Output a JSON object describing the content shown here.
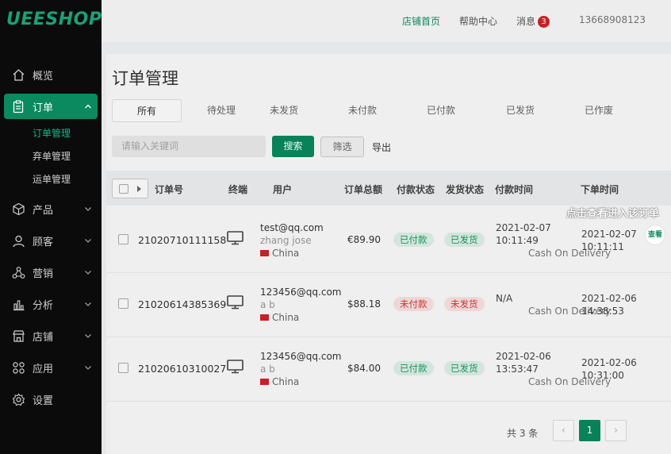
{
  "brand": {
    "logo": "UEESHOP",
    "accent": "#0a8a5e"
  },
  "sidebar": {
    "items": [
      {
        "label": "概览",
        "icon": "home-icon"
      },
      {
        "label": "订单",
        "icon": "clipboard-icon",
        "active": true,
        "expanded": true,
        "children": [
          "订单管理",
          "弃单管理",
          "运单管理"
        ]
      },
      {
        "label": "产品",
        "icon": "box-icon"
      },
      {
        "label": "顾客",
        "icon": "user-icon"
      },
      {
        "label": "营销",
        "icon": "share-icon"
      },
      {
        "label": "分析",
        "icon": "bar-chart-icon"
      },
      {
        "label": "店铺",
        "icon": "store-icon"
      },
      {
        "label": "应用",
        "icon": "apps-icon"
      },
      {
        "label": "设置",
        "icon": "gear-icon"
      }
    ]
  },
  "header": {
    "store_home": "店铺首页",
    "help": "帮助中心",
    "messages": "消息",
    "message_count": "3",
    "phone": "13668908123"
  },
  "page": {
    "title": "订单管理",
    "tabs": [
      "所有",
      "待处理",
      "未发货",
      "未付款",
      "已付款",
      "已发货",
      "已作废"
    ],
    "search_placeholder": "请输入关键词",
    "search_button": "搜索",
    "filter_button": "筛选",
    "export": "导出"
  },
  "table": {
    "headers": {
      "order_no": "订单号",
      "terminal": "终端",
      "user": "用户",
      "total": "订单总额",
      "pay_status": "付款状态",
      "ship_status": "发货状态",
      "pay_time": "付款时间",
      "order_time": "下单时间"
    },
    "rows": [
      {
        "order_no": "21020710111158",
        "email": "test@qq.com",
        "name": "zhang jose",
        "country": "China",
        "total": "€89.90",
        "pay_status": "已付款",
        "ship_status": "已发货",
        "pay_date": "2021-02-07",
        "pay_clock": "10:11:49",
        "pay_method": "Cash On Delivery",
        "order_date": "2021-02-07",
        "order_clock": "10:11:11"
      },
      {
        "order_no": "21020614385369",
        "email": "123456@qq.com",
        "name": "a b",
        "country": "China",
        "total": "$88.18",
        "pay_status": "未付款",
        "ship_status": "未发货",
        "pay_date": "N/A",
        "pay_clock": "",
        "pay_method": "Cash On Delivery",
        "order_date": "2021-02-06",
        "order_clock": "14:38:53"
      },
      {
        "order_no": "21020610310027",
        "email": "123456@qq.com",
        "name": "a b",
        "country": "China",
        "total": "$84.00",
        "pay_status": "已付款",
        "ship_status": "已发货",
        "pay_date": "2021-02-06",
        "pay_clock": "13:53:47",
        "pay_method": "Cash On Delivery",
        "order_date": "2021-02-06",
        "order_clock": "10:31:00"
      }
    ]
  },
  "pagination": {
    "total_text": "共 3 条",
    "current": "1",
    "prev": "‹",
    "next": "›"
  },
  "guide": {
    "tip": "点击查看进入该订单",
    "view_label": "查看"
  }
}
